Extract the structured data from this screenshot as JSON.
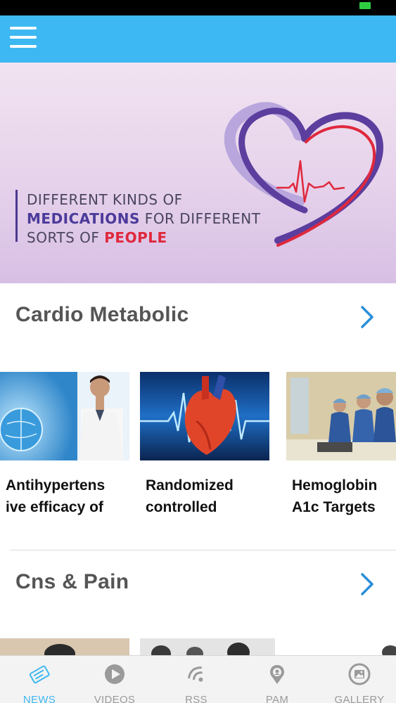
{
  "app": {
    "theme_color": "#3db8f2",
    "menu_icon": "hamburger-menu-icon"
  },
  "banner": {
    "line1": "DIFFERENT KINDS OF",
    "line2_highlight": "MEDICATIONS",
    "line2_rest": " FOR DIFFERENT",
    "line3_prefix": "SORTS OF ",
    "line3_highlight": "PEOPLE",
    "colors": {
      "purple": "#4b3a9a",
      "red": "#e0283c"
    }
  },
  "sections": [
    {
      "title": "Cardio Metabolic",
      "more_icon": "chevron-right-icon",
      "cards": [
        {
          "title_line1": "Antihypertens",
          "title_line2": "ive efficacy of"
        },
        {
          "title_line1": "Randomized",
          "title_line2": "controlled"
        },
        {
          "title_line1": "Hemoglobin",
          "title_line2": "A1c Targets"
        }
      ]
    },
    {
      "title": "Cns & Pain",
      "more_icon": "chevron-right-icon"
    }
  ],
  "tabs": [
    {
      "label": "NEWS",
      "icon": "news-icon",
      "active": true
    },
    {
      "label": "VIDEOS",
      "icon": "play-icon",
      "active": false
    },
    {
      "label": "RSS",
      "icon": "rss-icon",
      "active": false
    },
    {
      "label": "PAM",
      "icon": "pam-icon",
      "active": false
    },
    {
      "label": "GALLERY",
      "icon": "gallery-icon",
      "active": false
    }
  ]
}
